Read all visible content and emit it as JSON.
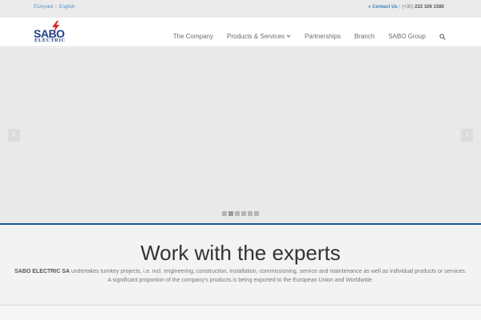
{
  "topbar": {
    "languages": [
      "Ελληνικά",
      "English"
    ],
    "language_separator": "|",
    "contact_link": "» Contact Us",
    "contact_separator": "|",
    "phone_prefix": "(+30)",
    "phone_number": "222 106 1580"
  },
  "header": {
    "logo_main": "SABO",
    "logo_sub": "ELECTRIC",
    "nav": [
      {
        "label": "The Company"
      },
      {
        "label": "Products & Services"
      },
      {
        "label": "Partnerships"
      },
      {
        "label": "Branch"
      },
      {
        "label": "SABO Group"
      }
    ]
  },
  "slider": {
    "prev_icon": "‹",
    "next_icon": "›",
    "dot_count": 6,
    "active_dot": 1
  },
  "content": {
    "headline": "Work with the experts",
    "company_name": "SABO ELECTRIC SA",
    "desc_line1_rest": " undertakes turnkey projects, i.e. incl. engineering, construction, installation, commissioning, service and maintenance as well as individual products or services.",
    "desc_line2": "A significant proportion of the company's products is being exported to the European Union and Worldwide."
  },
  "icons": {
    "search": "search-icon",
    "chevron": "chevron-down-icon",
    "bolt": "lightning-bolt-icon"
  },
  "colors": {
    "brand_blue": "#1f3f8a",
    "accent_line": "#1c5a91",
    "link_blue": "#3f7fc0",
    "bolt_red": "#d8242b"
  }
}
